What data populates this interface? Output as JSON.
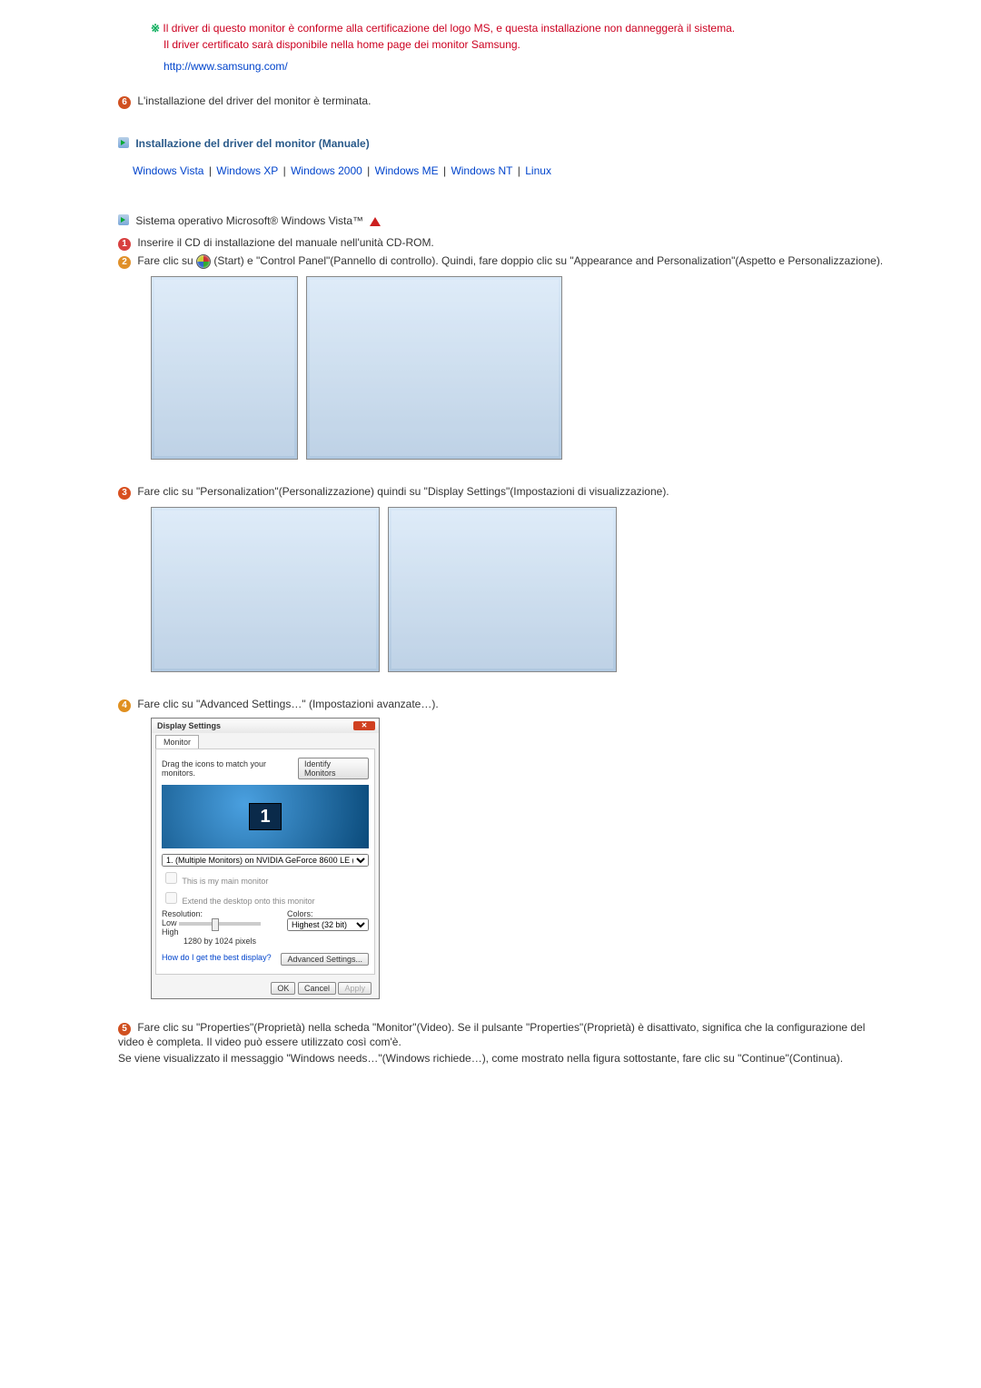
{
  "top": {
    "line1": "Il driver di questo monitor è conforme alla certificazione del logo MS, e questa installazione non danneggerà il sistema.",
    "line2": "Il driver certificato sarà disponibile nella home page dei monitor Samsung.",
    "url": "http://www.samsung.com/"
  },
  "step6": "L'installazione del driver del monitor è terminata.",
  "manual_title": "Installazione del driver del monitor (Manuale)",
  "os_links": {
    "vista": "Windows Vista",
    "xp": "Windows XP",
    "w2000": "Windows 2000",
    "wme": "Windows ME",
    "wnt": "Windows NT",
    "linux": "Linux"
  },
  "vista_heading": "Sistema operativo Microsoft® Windows Vista™",
  "vista_steps": {
    "s1": "Inserire il CD di installazione del manuale nell'unità CD-ROM.",
    "s2_a": "Fare clic su ",
    "s2_b": "(Start) e \"Control Panel\"(Pannello di controllo). Quindi, fare doppio clic su \"Appearance and Personalization\"(Aspetto e Personalizzazione).",
    "s3": "Fare clic su \"Personalization\"(Personalizzazione) quindi su \"Display Settings\"(Impostazioni di visualizzazione).",
    "s4": "Fare clic su \"Advanced Settings…\" (Impostazioni avanzate…).",
    "s5": "Fare clic su \"Properties\"(Proprietà) nella scheda \"Monitor\"(Video). Se il pulsante \"Properties\"(Proprietà) è disattivato, significa che la configurazione del video è completa. Il video può essere utilizzato così com'è.",
    "s5b": "Se viene visualizzato il messaggio \"Windows needs…\"(Windows richiede…), come mostrato nella figura sottostante, fare clic su \"Continue\"(Continua)."
  },
  "dlg": {
    "title": "Display Settings",
    "tab": "Monitor",
    "drag": "Drag the icons to match your monitors.",
    "identify": "Identify Monitors",
    "monitor_num": "1",
    "device": "1. (Multiple Monitors) on NVIDIA GeForce 8600 LE (Microsoft Corporation - …",
    "chk_main": "This is my main monitor",
    "chk_extend": "Extend the desktop onto this monitor",
    "resolution_lbl": "Resolution:",
    "low": "Low",
    "high": "High",
    "res_value": "1280 by 1024 pixels",
    "colors_lbl": "Colors:",
    "colors_val": "Highest (32 bit)",
    "best_link": "How do I get the best display?",
    "adv": "Advanced Settings...",
    "ok": "OK",
    "cancel": "Cancel",
    "apply": "Apply"
  }
}
